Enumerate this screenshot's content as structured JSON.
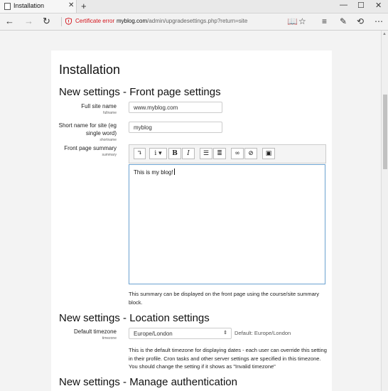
{
  "tab": {
    "title": "Installation"
  },
  "address": {
    "cert_label": "Certificate error",
    "domain": "myblog.com",
    "path": "/admin/upgradesettings.php?return=site"
  },
  "page": {
    "title": "Installation",
    "section_front": "New settings - Front page settings",
    "fullname": {
      "label": "Full site name",
      "sub": "fullname",
      "value": "www.myblog.com"
    },
    "shortname": {
      "label": "Short name for site (eg single word)",
      "sub": "shortname",
      "value": "myblog"
    },
    "summary": {
      "label": "Front page summary",
      "sub": "summary",
      "text": "This is my blog!",
      "desc": "This summary can be displayed on the front page using the course/site summary block."
    },
    "section_location": "New settings - Location settings",
    "timezone": {
      "label": "Default timezone",
      "sub": "timezone",
      "value": "Europe/London",
      "default": "Default: Europe/London",
      "desc": "This is the default timezone for displaying dates - each user can override this setting in their profile. Cron tasks and other server settings are specified in this timezone. You should change the setting if it shows as \"Invalid timezone\""
    },
    "section_auth": "New settings - Manage authentication"
  },
  "toolbar_icons": [
    "collapse-icon",
    "info-icon",
    "bold-icon",
    "italic-icon",
    "unordered-list-icon",
    "ordered-list-icon",
    "link-icon",
    "unlink-icon",
    "image-icon"
  ]
}
